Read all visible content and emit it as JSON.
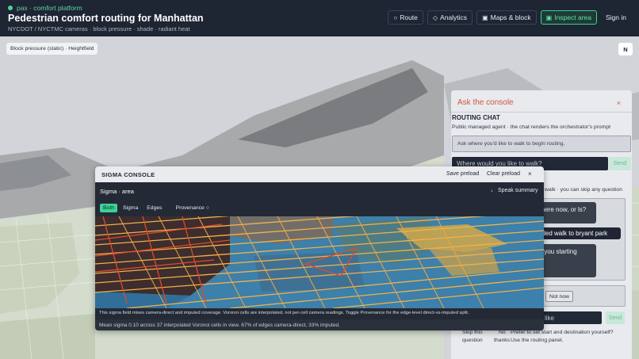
{
  "header": {
    "brand": "pax · comfort platform",
    "title": "Pedestrian comfort routing for Manhattan",
    "subtitle": "NYCDOT / NYCTMC cameras · block pressure · shade · radiant heat",
    "nav": {
      "route": "Route",
      "analytics": "Analytics",
      "maps": "Maps & block",
      "inspect": "Inspect area",
      "signin": "Sign in"
    }
  },
  "map": {
    "layer_chip": "Block pressure (static) · Heightfield",
    "compass": "N"
  },
  "ask": {
    "title": "Ask the console",
    "close": "×",
    "section_title": "ROUTING CHAT",
    "section_subtitle": "Public managed agent · the chat renders the orchestrator's prompt",
    "hint": "Ask where you'd like to walk to begin routing.",
    "input_placeholder": "Where would you like to walk?",
    "send": "Send",
    "walk_note": "walk · you can skip any question",
    "bubble_1": "where now, or ls?",
    "bubble_2": "aded walk to bryant park",
    "bubble_3": "re you starting",
    "not_now": "Not now",
    "input2_text": "u like",
    "send2": "Send",
    "skip": "Skip this question",
    "no_thanks_1": "No",
    "no_thanks_2": "thanks",
    "prefer": "Prefer to set start and destination yourself? Use the routing panel."
  },
  "sigma": {
    "title": "SIGMA CONSOLE",
    "save": "Save preload",
    "clear": "Clear preload",
    "close": "×",
    "area": "Sigma · area",
    "speak": "♩ Speak summary",
    "tabs": {
      "both": "Both",
      "sigma": "Sigma",
      "edges": "Edges"
    },
    "provenance": "Provenance ○",
    "note": "This sigma field mixes camera-direct and imputed coverage. Voronoi cells are interpolated, not per-cell camera readings. Toggle Provenance for the edge-level direct-vs-imputed split.",
    "footer": "Mean sigma 0.10 across 37 interpolated Voronoi cells in view. 67% of edges camera-direct, 33% imputed."
  },
  "colors": {
    "accent": "#3ecf95",
    "header_bg": "#1e2533",
    "ask_title": "#d2543d",
    "sigma_water": "#3a7ea8"
  }
}
